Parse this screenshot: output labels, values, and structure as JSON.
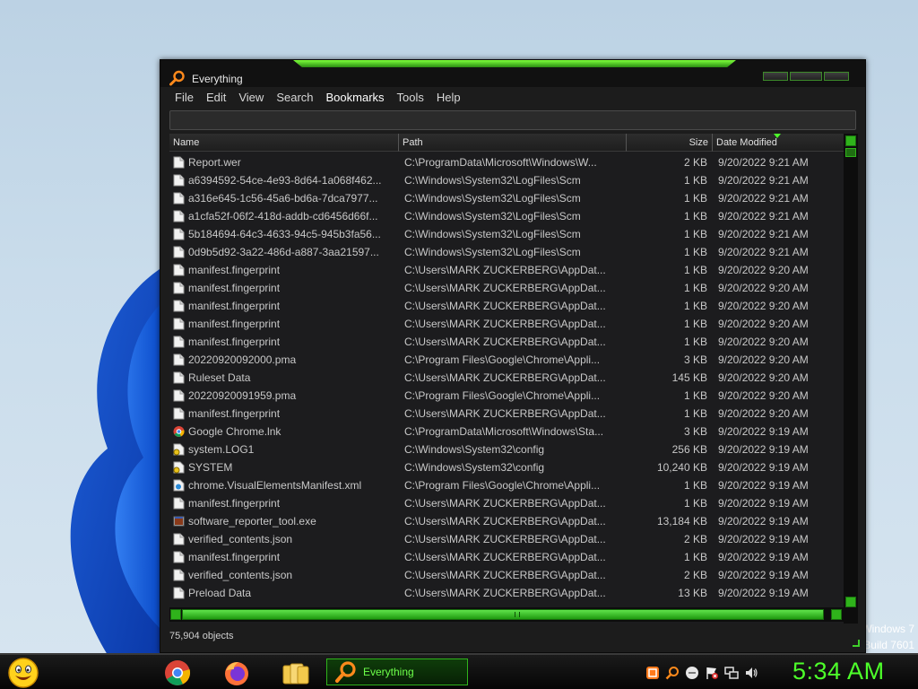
{
  "window": {
    "title": "Everything",
    "menu": [
      "File",
      "Edit",
      "View",
      "Search",
      "Bookmarks",
      "Tools",
      "Help"
    ],
    "active_menu": "Bookmarks",
    "search_value": "",
    "columns": {
      "name": "Name",
      "path": "Path",
      "size": "Size",
      "date": "Date Modified"
    },
    "sort_column": "Date Modified",
    "sort_direction": "descending",
    "rows": [
      {
        "name": "Report.wer",
        "path": "C:\\ProgramData\\Microsoft\\Windows\\W...",
        "size": "2 KB",
        "date": "9/20/2022 9:21 AM",
        "icon": "document-icon"
      },
      {
        "name": "a6394592-54ce-4e93-8d64-1a068f462...",
        "path": "C:\\Windows\\System32\\LogFiles\\Scm",
        "size": "1 KB",
        "date": "9/20/2022 9:21 AM",
        "icon": "document-icon"
      },
      {
        "name": "a316e645-1c56-45a6-bd6a-7dca7977...",
        "path": "C:\\Windows\\System32\\LogFiles\\Scm",
        "size": "1 KB",
        "date": "9/20/2022 9:21 AM",
        "icon": "document-icon"
      },
      {
        "name": "a1cfa52f-06f2-418d-addb-cd6456d66f...",
        "path": "C:\\Windows\\System32\\LogFiles\\Scm",
        "size": "1 KB",
        "date": "9/20/2022 9:21 AM",
        "icon": "document-icon"
      },
      {
        "name": "5b184694-64c3-4633-94c5-945b3fa56...",
        "path": "C:\\Windows\\System32\\LogFiles\\Scm",
        "size": "1 KB",
        "date": "9/20/2022 9:21 AM",
        "icon": "document-icon"
      },
      {
        "name": "0d9b5d92-3a22-486d-a887-3aa21597...",
        "path": "C:\\Windows\\System32\\LogFiles\\Scm",
        "size": "1 KB",
        "date": "9/20/2022 9:21 AM",
        "icon": "document-icon"
      },
      {
        "name": "manifest.fingerprint",
        "path": "C:\\Users\\MARK ZUCKERBERG\\AppDat...",
        "size": "1 KB",
        "date": "9/20/2022 9:20 AM",
        "icon": "document-icon"
      },
      {
        "name": "manifest.fingerprint",
        "path": "C:\\Users\\MARK ZUCKERBERG\\AppDat...",
        "size": "1 KB",
        "date": "9/20/2022 9:20 AM",
        "icon": "document-icon"
      },
      {
        "name": "manifest.fingerprint",
        "path": "C:\\Users\\MARK ZUCKERBERG\\AppDat...",
        "size": "1 KB",
        "date": "9/20/2022 9:20 AM",
        "icon": "document-icon"
      },
      {
        "name": "manifest.fingerprint",
        "path": "C:\\Users\\MARK ZUCKERBERG\\AppDat...",
        "size": "1 KB",
        "date": "9/20/2022 9:20 AM",
        "icon": "document-icon"
      },
      {
        "name": "manifest.fingerprint",
        "path": "C:\\Users\\MARK ZUCKERBERG\\AppDat...",
        "size": "1 KB",
        "date": "9/20/2022 9:20 AM",
        "icon": "document-icon"
      },
      {
        "name": "20220920092000.pma",
        "path": "C:\\Program Files\\Google\\Chrome\\Appli...",
        "size": "3 KB",
        "date": "9/20/2022 9:20 AM",
        "icon": "document-icon"
      },
      {
        "name": "Ruleset Data",
        "path": "C:\\Users\\MARK ZUCKERBERG\\AppDat...",
        "size": "145 KB",
        "date": "9/20/2022 9:20 AM",
        "icon": "document-icon"
      },
      {
        "name": "20220920091959.pma",
        "path": "C:\\Program Files\\Google\\Chrome\\Appli...",
        "size": "1 KB",
        "date": "9/20/2022 9:20 AM",
        "icon": "document-icon"
      },
      {
        "name": "manifest.fingerprint",
        "path": "C:\\Users\\MARK ZUCKERBERG\\AppDat...",
        "size": "1 KB",
        "date": "9/20/2022 9:20 AM",
        "icon": "document-icon"
      },
      {
        "name": "Google Chrome.lnk",
        "path": "C:\\ProgramData\\Microsoft\\Windows\\Sta...",
        "size": "3 KB",
        "date": "9/20/2022 9:19 AM",
        "icon": "chrome-shortcut-icon"
      },
      {
        "name": "system.LOG1",
        "path": "C:\\Windows\\System32\\config",
        "size": "256 KB",
        "date": "9/20/2022 9:19 AM",
        "icon": "system-file-icon"
      },
      {
        "name": "SYSTEM",
        "path": "C:\\Windows\\System32\\config",
        "size": "10,240 KB",
        "date": "9/20/2022 9:19 AM",
        "icon": "system-file-icon"
      },
      {
        "name": "chrome.VisualElementsManifest.xml",
        "path": "C:\\Program Files\\Google\\Chrome\\Appli...",
        "size": "1 KB",
        "date": "9/20/2022 9:19 AM",
        "icon": "xml-file-icon"
      },
      {
        "name": "manifest.fingerprint",
        "path": "C:\\Users\\MARK ZUCKERBERG\\AppDat...",
        "size": "1 KB",
        "date": "9/20/2022 9:19 AM",
        "icon": "document-icon"
      },
      {
        "name": "software_reporter_tool.exe",
        "path": "C:\\Users\\MARK ZUCKERBERG\\AppDat...",
        "size": "13,184 KB",
        "date": "9/20/2022 9:19 AM",
        "icon": "executable-icon"
      },
      {
        "name": "verified_contents.json",
        "path": "C:\\Users\\MARK ZUCKERBERG\\AppDat...",
        "size": "2 KB",
        "date": "9/20/2022 9:19 AM",
        "icon": "document-icon"
      },
      {
        "name": "manifest.fingerprint",
        "path": "C:\\Users\\MARK ZUCKERBERG\\AppDat...",
        "size": "1 KB",
        "date": "9/20/2022 9:19 AM",
        "icon": "document-icon"
      },
      {
        "name": "verified_contents.json",
        "path": "C:\\Users\\MARK ZUCKERBERG\\AppDat...",
        "size": "2 KB",
        "date": "9/20/2022 9:19 AM",
        "icon": "document-icon"
      },
      {
        "name": "Preload Data",
        "path": "C:\\Users\\MARK ZUCKERBERG\\AppDat...",
        "size": "13 KB",
        "date": "9/20/2022 9:19 AM",
        "icon": "document-icon"
      }
    ],
    "status": "75,904 objects"
  },
  "desktop": {
    "watermark_line1": "Windows 7",
    "watermark_line2": "Build 7601"
  },
  "taskbar": {
    "start_icon": "smiley-start-icon",
    "pinned": [
      "chrome-icon",
      "firefox-icon",
      "folders-icon"
    ],
    "task_label": "Everything",
    "tray": [
      "tray-app-icon",
      "tray-search-icon",
      "tray-chat-icon",
      "tray-flag-icon",
      "tray-network-icon",
      "tray-volume-icon"
    ],
    "clock": "5:34 AM"
  },
  "colors": {
    "accent": "#4dff2a",
    "window_bg": "#1c1c1c",
    "text": "#c8c8c8"
  }
}
